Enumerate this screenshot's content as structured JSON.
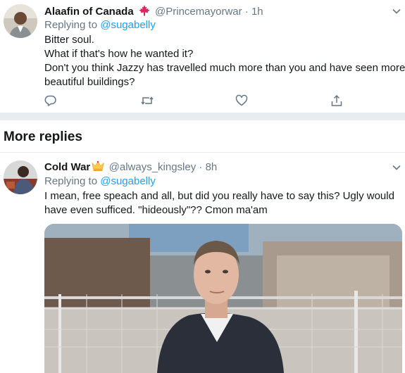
{
  "tweet1": {
    "name": "Alaafin of Canada",
    "flag_icon": "maple-leaf-icon",
    "handle": "@Princemayorwar",
    "dot": "·",
    "time": "1h",
    "replying_prefix": "Replying to",
    "replying_to": "@sugabelly",
    "lines": [
      "Bitter soul.",
      "What if that's how he wanted it?",
      "Don't you think Jazzy has travelled much more than you and have seen more",
      "beautiful buildings?"
    ]
  },
  "section": {
    "title": "More replies"
  },
  "tweet2": {
    "name": "Cold War",
    "crown_icon": "crown-icon",
    "handle": "@always_kingsley",
    "dot": "·",
    "time": "8h",
    "replying_prefix": "Replying to",
    "replying_to": "@sugabelly",
    "lines": [
      "I mean, free speach and all, but did you really have to say this? Ugly would",
      "have even sufficed. \"hideously\"?? Cmon ma'am"
    ]
  },
  "colors": {
    "link": "#1da1f2",
    "secondary_text": "#657786",
    "separator": "#e6ecf0",
    "maple_leaf": "#e0245e"
  },
  "icons": [
    "reply-icon",
    "retweet-icon",
    "like-icon",
    "share-icon",
    "chevron-down-icon"
  ]
}
